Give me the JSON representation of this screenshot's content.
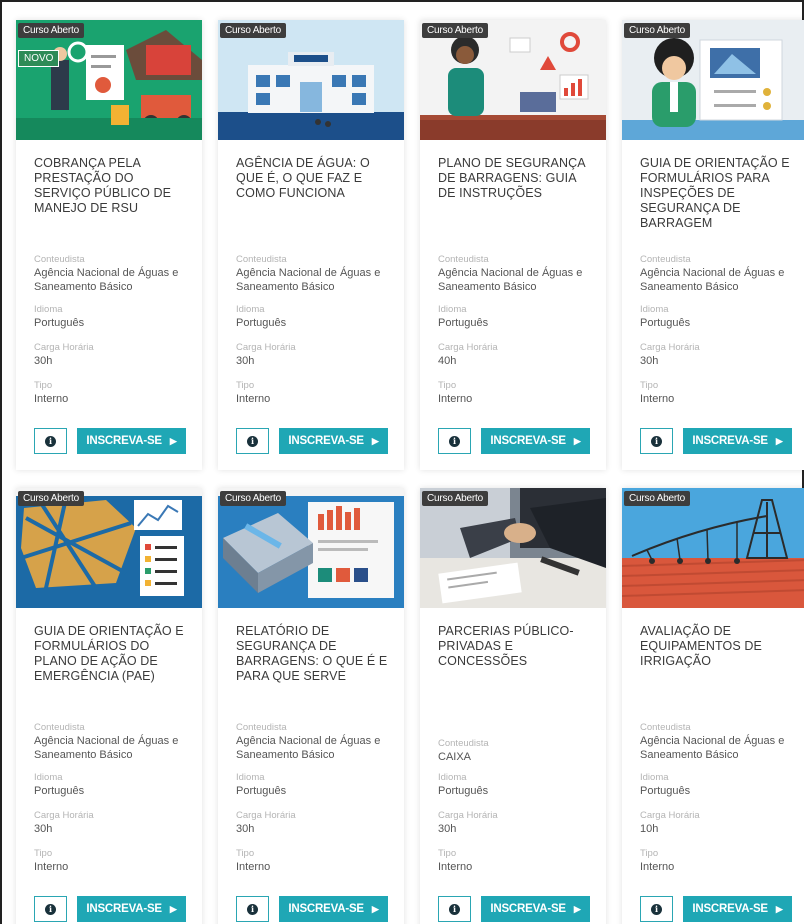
{
  "labels": {
    "contentist": "Conteudista",
    "language": "Idioma",
    "hours": "Carga Horária",
    "type": "Tipo",
    "enroll": "INSCREVA-SE",
    "info": "i"
  },
  "courses": [
    {
      "badge": "Curso Aberto",
      "new_badge": "NOVO",
      "title": "COBRANÇA PELA PRESTAÇÃO DO SERVIÇO PÚBLICO DE MANEJO DE RSU",
      "contentist": "Agência Nacional de Águas e Saneamento Básico",
      "language": "Português",
      "hours": "30h",
      "type": "Interno",
      "thumb_bg": "#1aa36f"
    },
    {
      "badge": "Curso Aberto",
      "title": "AGÊNCIA DE ÁGUA: O QUE É, O QUE FAZ E COMO FUNCIONA",
      "contentist": "Agência Nacional de Águas e Saneamento Básico",
      "language": "Português",
      "hours": "30h",
      "type": "Interno",
      "thumb_bg": "#cfe6f3"
    },
    {
      "badge": "Curso Aberto",
      "title": "PLANO DE SEGURANÇA DE BARRAGENS: GUIA DE INSTRUÇÕES",
      "contentist": "Agência Nacional de Águas e Saneamento Básico",
      "language": "Português",
      "hours": "40h",
      "type": "Interno",
      "thumb_bg": "#f3f3f3"
    },
    {
      "badge": "Curso Aberto",
      "title": "GUIA DE ORIENTAÇÃO E FORMULÁRIOS PARA INSPEÇÕES DE SEGURANÇA DE BARRAGEM",
      "contentist": "Agência Nacional de Águas e Saneamento Básico",
      "language": "Português",
      "hours": "30h",
      "type": "Interno",
      "thumb_bg": "#e9eef2"
    },
    {
      "badge": "Curso Aberto",
      "title": "GUIA DE ORIENTAÇÃO E FORMULÁRIOS DO PLANO DE AÇÃO DE EMERGÊNCIA (PAE)",
      "contentist": "Agência Nacional de Águas e Saneamento Básico",
      "language": "Português",
      "hours": "30h",
      "type": "Interno",
      "thumb_bg": "#1c6aa6"
    },
    {
      "badge": "Curso Aberto",
      "title": "RELATÓRIO DE SEGURANÇA DE BARRAGENS: O QUE É E PARA QUE SERVE",
      "contentist": "Agência Nacional de Águas e Saneamento Básico",
      "language": "Português",
      "hours": "30h",
      "type": "Interno",
      "thumb_bg": "#2a7fc0"
    },
    {
      "badge": "Curso Aberto",
      "title": "PARCERIAS PÚBLICO-PRIVADAS E CONCESSÕES",
      "contentist": "CAIXA",
      "language": "Português",
      "hours": "30h",
      "type": "Interno",
      "thumb_bg": "#7b8590"
    },
    {
      "badge": "Curso Aberto",
      "title": "AVALIAÇÃO DE EQUIPAMENTOS DE IRRIGAÇÃO",
      "contentist": "Agência Nacional de Águas e Saneamento Básico",
      "language": "Português",
      "hours": "10h",
      "type": "Interno",
      "thumb_bg": "#3f9bd6"
    }
  ]
}
